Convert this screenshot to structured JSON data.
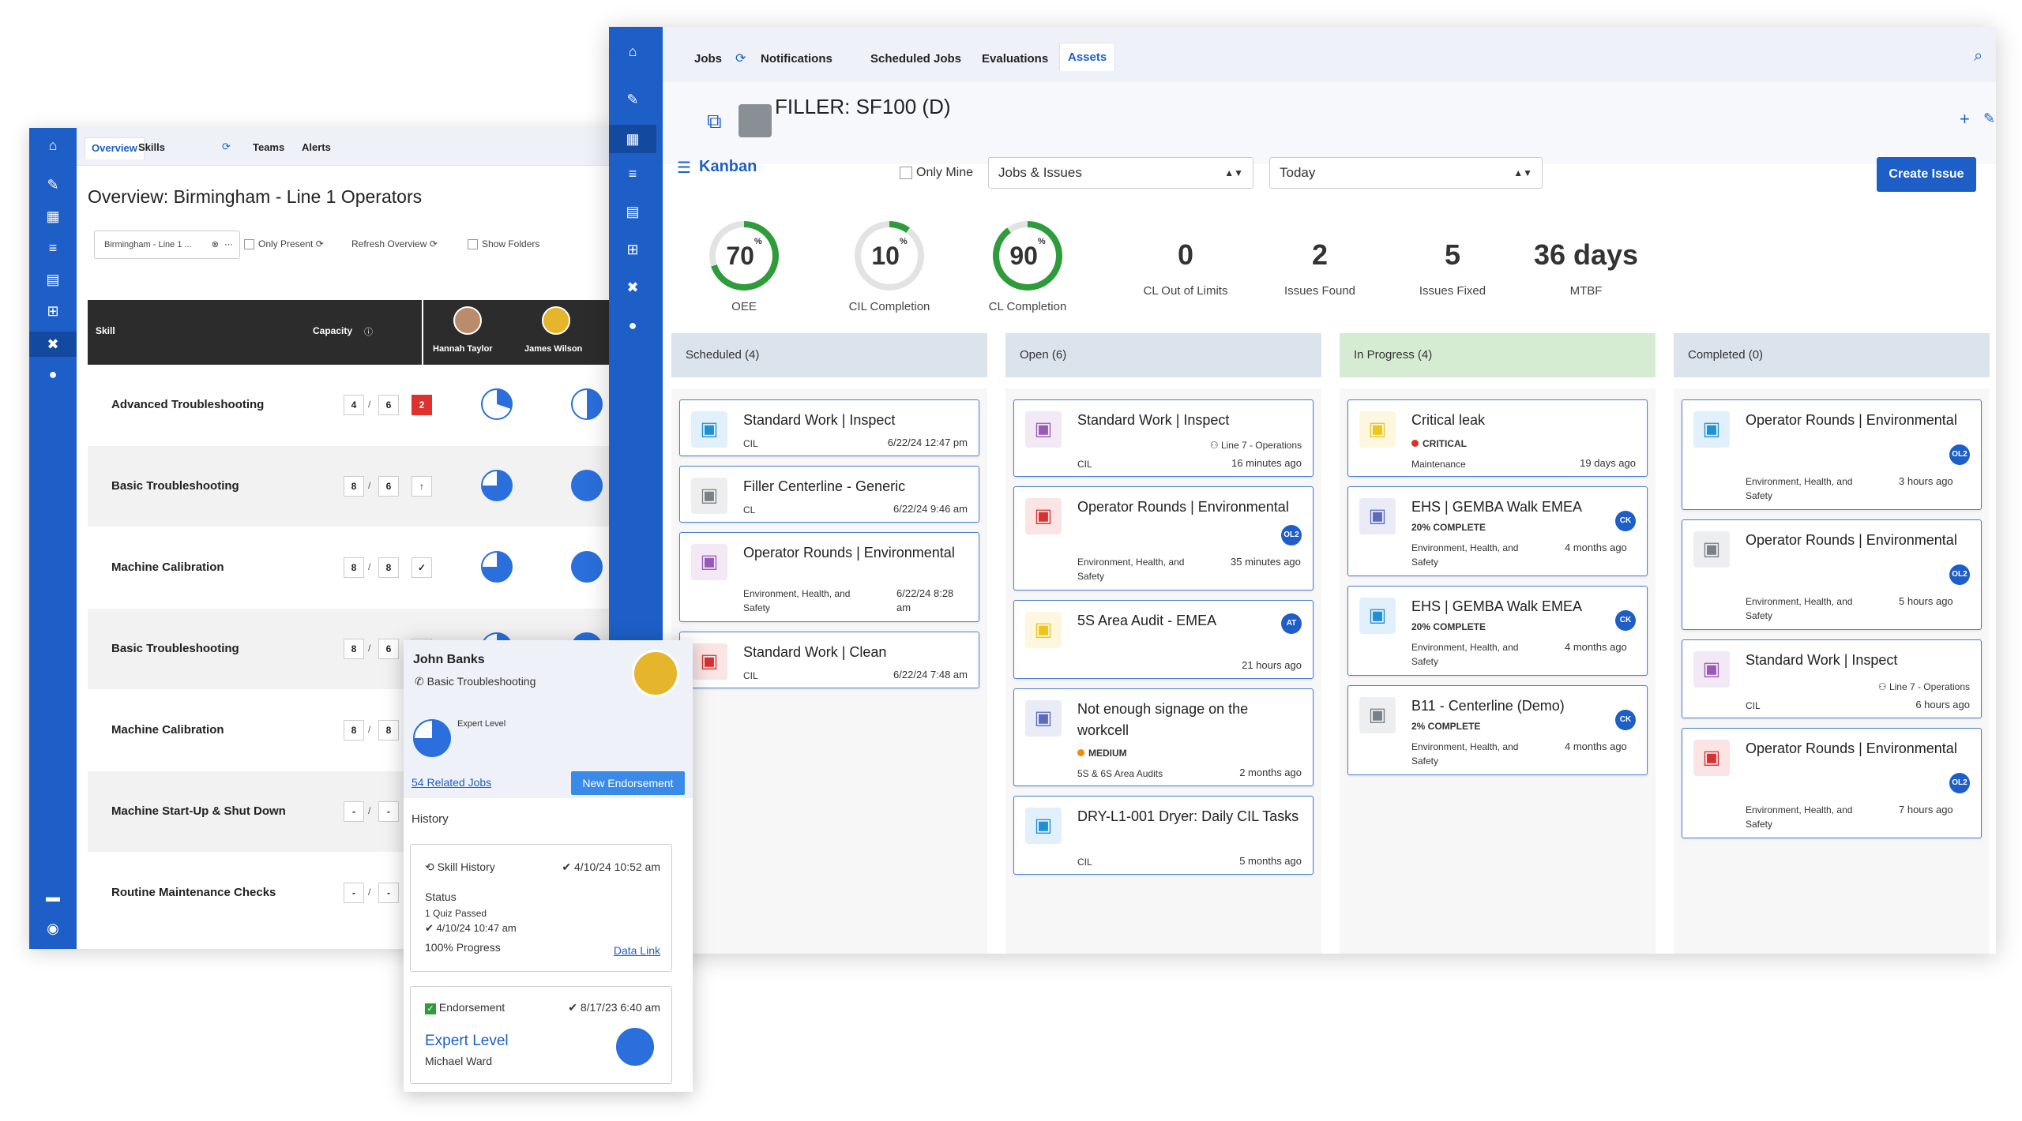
{
  "back": {
    "tabs": [
      "Overview",
      "Skills",
      "Teams",
      "Alerts"
    ],
    "title": "Overview: Birmingham - Line 1 Operators",
    "filter_value": "Birmingham - Line 1 ...",
    "only_present": "Only Present",
    "refresh": "Refresh Overview",
    "show_folders": "Show Folders",
    "skill_header": "Skill",
    "capacity_header": "Capacity",
    "operators": [
      "Hannah Taylor",
      "James Wilson"
    ],
    "rows": [
      {
        "skill": "Advanced Troubleshooting",
        "a": "4",
        "b": "6",
        "c": "2"
      },
      {
        "skill": "Basic Troubleshooting",
        "a": "8",
        "b": "6",
        "c": "↑"
      },
      {
        "skill": "Machine Calibration",
        "a": "8",
        "b": "8",
        "c": "✓"
      },
      {
        "skill": "Basic Troubleshooting",
        "a": "8",
        "b": "6",
        "c": "↑"
      },
      {
        "skill": "Machine Calibration",
        "a": "8",
        "b": "8",
        "c": "✓"
      },
      {
        "skill": "Machine Start-Up & Shut Down",
        "a": "-",
        "b": "-",
        "c": ""
      },
      {
        "skill": "Routine Maintenance Checks",
        "a": "-",
        "b": "-",
        "c": ""
      }
    ]
  },
  "main": {
    "tabs": [
      "Jobs",
      "Notifications",
      "Scheduled Jobs",
      "Evaluations",
      "Assets"
    ],
    "asset_title": "FILLER: SF100 (D)",
    "kanban": "Kanban",
    "only_mine": "Only Mine",
    "select_type": "Jobs & Issues",
    "select_date": "Today",
    "create_issue": "Create Issue",
    "kpis": {
      "oee": {
        "value": "70",
        "unit": "%",
        "label": "OEE"
      },
      "cil_completion_1": {
        "value": "10",
        "unit": "%",
        "label": "CIL Completion"
      },
      "cl_completion": {
        "value": "90",
        "unit": "%",
        "label": "CL Completion"
      },
      "cl_out": {
        "value": "0",
        "label": "CL Out of Limits"
      },
      "issues_found": {
        "value": "2",
        "label": "Issues Found"
      },
      "issues_fixed": {
        "value": "5",
        "label": "Issues Fixed"
      },
      "mtbf": {
        "value": "36 days",
        "label": "MTBF"
      }
    },
    "columns": [
      {
        "label": "Scheduled (4)",
        "color": "#dbe3ec"
      },
      {
        "label": "Open (6)",
        "color": "#dbe3ec"
      },
      {
        "label": "In Progress (4)",
        "color": "#d6ecd2"
      },
      {
        "label": "Completed (0)",
        "color": "#dbe3ec"
      }
    ],
    "scheduled": [
      {
        "title": "Standard Work | Inspect",
        "sub": "CIL",
        "date": "6/22/24 12:47 pm"
      },
      {
        "title": "Filler Centerline - Generic",
        "sub": "CL",
        "date": "6/22/24 9:46 am"
      },
      {
        "title": "Operator Rounds | Environmental",
        "sub": "Environment, Health, and Safety",
        "date": "6/22/24 8:28 am"
      },
      {
        "title": "Standard Work | Clean",
        "sub": "CIL",
        "date": "6/22/24 7:48 am"
      }
    ],
    "open": [
      {
        "title": "Standard Work | Inspect",
        "sub": "CIL",
        "team": "Line 7 - Operations",
        "date": "16 minutes ago"
      },
      {
        "title": "Operator Rounds | Environmental",
        "sub": "Environment, Health, and Safety",
        "badge": "OL2",
        "date": "35 minutes ago"
      },
      {
        "title": "5S Area Audit - EMEA",
        "badge": "AT",
        "date": "21 hours ago"
      },
      {
        "title": "Not enough signage on the workcell",
        "priority": "MEDIUM",
        "sub": "5S & 6S Area Audits",
        "date": "2 months ago"
      },
      {
        "title": "DRY-L1-001 Dryer: Daily CIL Tasks",
        "sub": "CIL",
        "date": "5 months ago"
      }
    ],
    "in_progress": [
      {
        "title": "Critical leak",
        "priority": "CRITICAL",
        "sub": "Maintenance",
        "date": "19 days ago"
      },
      {
        "title": "EHS | GEMBA Walk EMEA",
        "progress": "20% COMPLETE",
        "sub": "Environment, Health, and Safety",
        "badge": "CK",
        "date": "4 months ago"
      },
      {
        "title": "EHS | GEMBA Walk EMEA",
        "progress": "20% COMPLETE",
        "sub": "Environment, Health, and Safety",
        "badge": "CK",
        "date": "4 months ago"
      },
      {
        "title": "B11 - Centerline (Demo)",
        "progress": "2% COMPLETE",
        "sub": "Environment, Health, and Safety",
        "badge": "CK",
        "date": "4 months ago"
      }
    ],
    "completed": [
      {
        "title": "Operator Rounds | Environmental",
        "sub": "Environment, Health, and Safety",
        "badge": "OL2",
        "date": "3 hours ago"
      },
      {
        "title": "Operator Rounds | Environmental",
        "sub": "Environment, Health, and Safety",
        "badge": "OL2",
        "date": "5 hours ago"
      },
      {
        "title": "Standard Work | Inspect",
        "sub": "CIL",
        "team": "Line 7 - Operations",
        "date": "6 hours ago"
      },
      {
        "title": "Operator Rounds | Environmental",
        "sub": "Environment, Health, and Safety",
        "badge": "OL2",
        "date": "7 hours ago"
      }
    ]
  },
  "popup": {
    "name": "John Banks",
    "skill": "Basic Troubleshooting",
    "level": "Expert Level",
    "related": "54 Related Jobs",
    "endorse_btn": "New Endorsement",
    "history": "History",
    "skill_history": "Skill History",
    "skill_history_date": "4/10/24 10:52 am",
    "status": "Status",
    "quiz": "1 Quiz Passed",
    "quiz_date": "4/10/24 10:47 am",
    "progress": "100% Progress",
    "data_link": "Data Link",
    "endorsement": "Endorsement",
    "endorsement_date": "8/17/23 6:40 am",
    "endorse_level": "Expert Level",
    "endorser": "Michael Ward"
  },
  "colors": {
    "accent": "#1d5fc6",
    "green": "#2e9c3a",
    "critical": "#d63232",
    "medium": "#f08c00"
  }
}
